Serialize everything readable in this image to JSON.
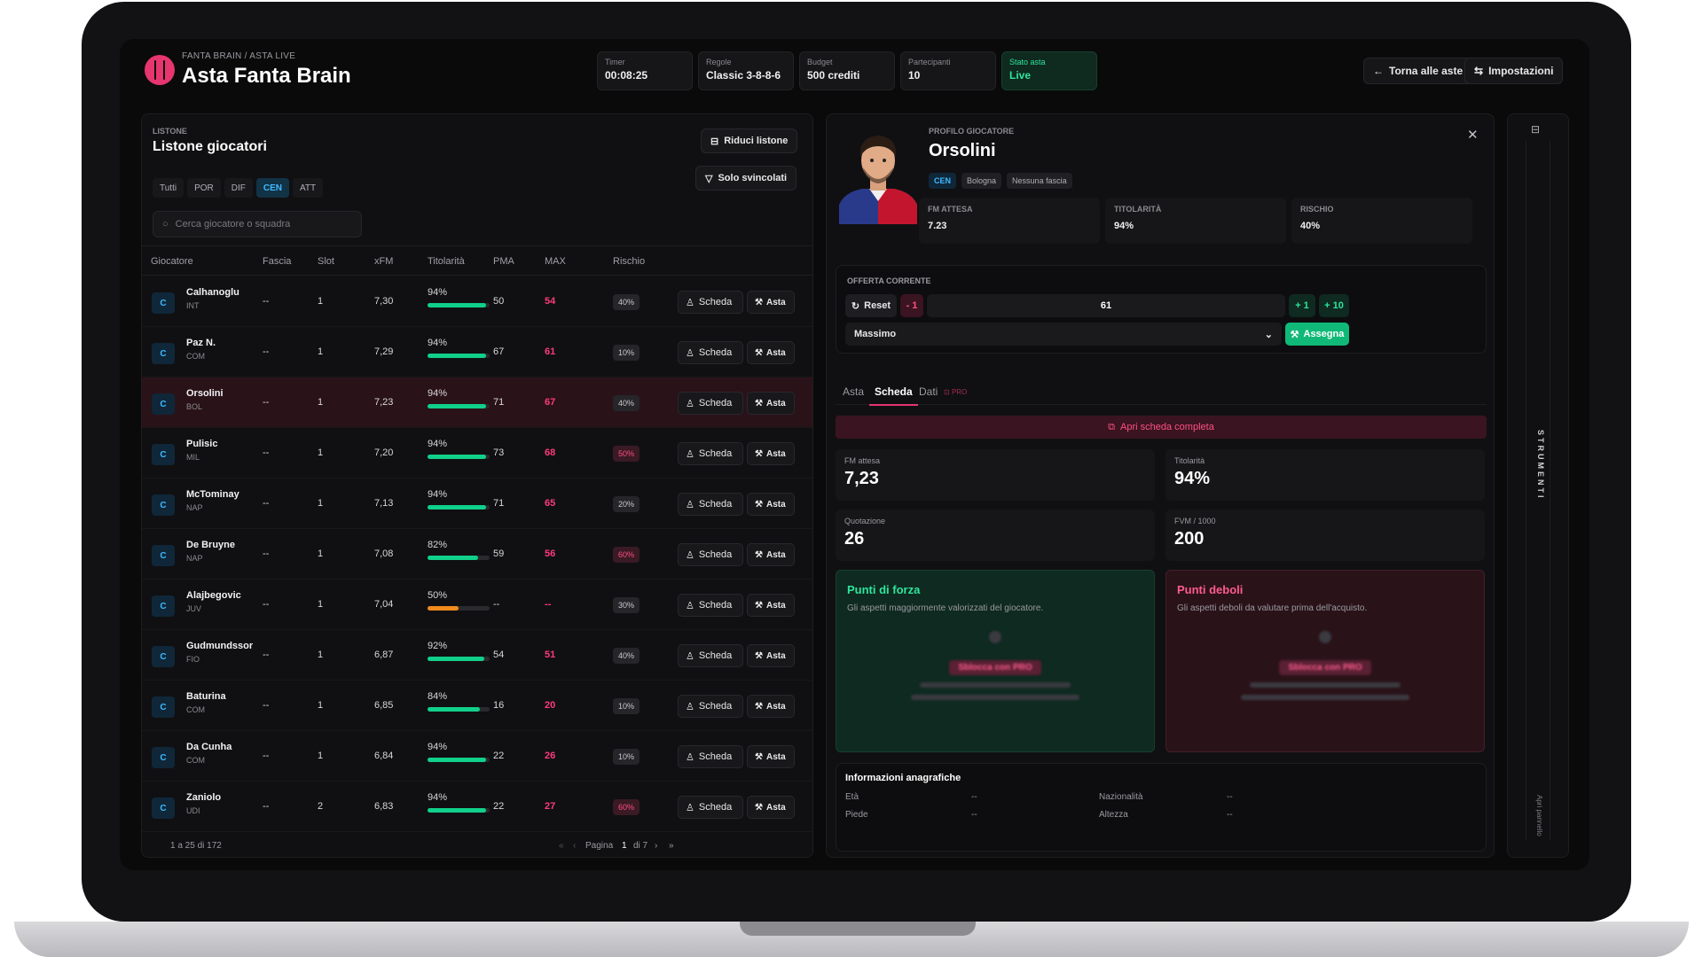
{
  "header": {
    "breadcrumb": "FANTA BRAIN / ASTA LIVE",
    "title": "Asta Fanta Brain",
    "stats": [
      {
        "label": "Timer",
        "value": "00:08:25"
      },
      {
        "label": "Regole",
        "value": "Classic 3-8-8-6"
      },
      {
        "label": "Budget",
        "value": "500 crediti"
      },
      {
        "label": "Partecipanti",
        "value": "10"
      },
      {
        "label": "Stato asta",
        "value": "Live"
      }
    ],
    "back_label": "Torna alle aste",
    "settings_label": "Impostazioni"
  },
  "list": {
    "small": "LISTONE",
    "title": "Listone giocatori",
    "reduce_label": "Riduci listone",
    "free_label": "Solo svincolati",
    "filters": [
      "Tutti",
      "POR",
      "DIF",
      "CEN",
      "ATT"
    ],
    "active_filter": "CEN",
    "search_placeholder": "Cerca giocatore o squadra",
    "columns": [
      "Giocatore",
      "Fascia",
      "Slot",
      "xFM",
      "Titolarità",
      "PMA",
      "MAX",
      "Rischio"
    ],
    "action_scheda": "Scheda",
    "action_asta": "Asta",
    "rows": [
      {
        "role": "C",
        "name": "Calhanoglu",
        "team": "INT",
        "fascia": "--",
        "slot": "1",
        "xfm": "7,30",
        "tit": "94%",
        "tit_pct": 94,
        "pma": "50",
        "max": "54",
        "risk": "40%",
        "risk_hi": false,
        "selected": false
      },
      {
        "role": "C",
        "name": "Paz N.",
        "team": "COM",
        "fascia": "--",
        "slot": "1",
        "xfm": "7,29",
        "tit": "94%",
        "tit_pct": 94,
        "pma": "67",
        "max": "61",
        "risk": "10%",
        "risk_hi": false,
        "selected": false
      },
      {
        "role": "C",
        "name": "Orsolini",
        "team": "BOL",
        "fascia": "--",
        "slot": "1",
        "xfm": "7,23",
        "tit": "94%",
        "tit_pct": 94,
        "pma": "71",
        "max": "67",
        "risk": "40%",
        "risk_hi": false,
        "selected": true
      },
      {
        "role": "C",
        "name": "Pulisic",
        "team": "MIL",
        "fascia": "--",
        "slot": "1",
        "xfm": "7,20",
        "tit": "94%",
        "tit_pct": 94,
        "pma": "73",
        "max": "68",
        "risk": "50%",
        "risk_hi": true,
        "selected": false
      },
      {
        "role": "C",
        "name": "McTominay",
        "team": "NAP",
        "fascia": "--",
        "slot": "1",
        "xfm": "7,13",
        "tit": "94%",
        "tit_pct": 94,
        "pma": "71",
        "max": "65",
        "risk": "20%",
        "risk_hi": false,
        "selected": false
      },
      {
        "role": "C",
        "name": "De Bruyne",
        "team": "NAP",
        "fascia": "--",
        "slot": "1",
        "xfm": "7,08",
        "tit": "82%",
        "tit_pct": 82,
        "pma": "59",
        "max": "56",
        "risk": "60%",
        "risk_hi": true,
        "selected": false
      },
      {
        "role": "C",
        "name": "Alajbegovic",
        "team": "JUV",
        "fascia": "--",
        "slot": "1",
        "xfm": "7,04",
        "tit": "50%",
        "tit_pct": 50,
        "pma": "--",
        "max": "--",
        "risk": "30%",
        "risk_hi": false,
        "selected": false
      },
      {
        "role": "C",
        "name": "Gudmundssor",
        "team": "FIO",
        "fascia": "--",
        "slot": "1",
        "xfm": "6,87",
        "tit": "92%",
        "tit_pct": 92,
        "pma": "54",
        "max": "51",
        "risk": "40%",
        "risk_hi": false,
        "selected": false
      },
      {
        "role": "C",
        "name": "Baturina",
        "team": "COM",
        "fascia": "--",
        "slot": "1",
        "xfm": "6,85",
        "tit": "84%",
        "tit_pct": 84,
        "pma": "16",
        "max": "20",
        "risk": "10%",
        "risk_hi": false,
        "selected": false
      },
      {
        "role": "C",
        "name": "Da Cunha",
        "team": "COM",
        "fascia": "--",
        "slot": "1",
        "xfm": "6,84",
        "tit": "94%",
        "tit_pct": 94,
        "pma": "22",
        "max": "26",
        "risk": "10%",
        "risk_hi": false,
        "selected": false
      },
      {
        "role": "C",
        "name": "Zaniolo",
        "team": "UDI",
        "fascia": "--",
        "slot": "2",
        "xfm": "6,83",
        "tit": "94%",
        "tit_pct": 94,
        "pma": "22",
        "max": "27",
        "risk": "60%",
        "risk_hi": true,
        "selected": false
      }
    ],
    "footer": {
      "range": "1 a 25 di 172",
      "page_label": "Pagina",
      "page": "1",
      "of": "di 7"
    }
  },
  "profile": {
    "small": "PROFILO GIOCATORE",
    "name": "Orsolini",
    "tags": [
      "CEN",
      "Bologna",
      "Nessuna fascia"
    ],
    "kpis": [
      {
        "label": "FM ATTESA",
        "value": "7.23"
      },
      {
        "label": "TITOLARITÀ",
        "value": "94%"
      },
      {
        "label": "RISCHIO",
        "value": "40%"
      }
    ],
    "offer": {
      "label": "OFFERTA CORRENTE",
      "reset": "Reset",
      "minus": "- 1",
      "value": "61",
      "plus1": "+ 1",
      "plus10": "+ 10",
      "select": "Massimo",
      "assign": "Assegna"
    },
    "tabs": [
      "Asta",
      "Scheda",
      "Dati"
    ],
    "active_tab": "Scheda",
    "pro_badge": "PRO",
    "open_full": "Apri scheda completa",
    "metrics": [
      {
        "label": "FM attesa",
        "value": "7,23"
      },
      {
        "label": "Titolarità",
        "value": "94%"
      },
      {
        "label": "Quotazione",
        "value": "26"
      },
      {
        "label": "FVM / 1000",
        "value": "200"
      }
    ],
    "strengths": {
      "title": "Punti di forza",
      "desc": "Gli aspetti maggiormente valorizzati del giocatore.",
      "unlock": "Sblocca con PRO"
    },
    "weaknesses": {
      "title": "Punti deboli",
      "desc": "Gli aspetti deboli da valutare prima dell'acquisto.",
      "unlock": "Sblocca con PRO"
    },
    "info": {
      "title": "Informazioni anagrafiche",
      "eta": "Età",
      "eta_v": "--",
      "naz": "Nazionalità",
      "naz_v": "--",
      "piede": "Piede",
      "piede_v": "--",
      "altezza": "Altezza",
      "altezza_v": "--"
    }
  },
  "tools": {
    "title": "STRUMENTI",
    "open": "Apri pannello"
  },
  "colors": {
    "accent": "#e6356f",
    "green": "#10d08a",
    "blue": "#3fb9ff",
    "bg": "#0a0a0b"
  }
}
